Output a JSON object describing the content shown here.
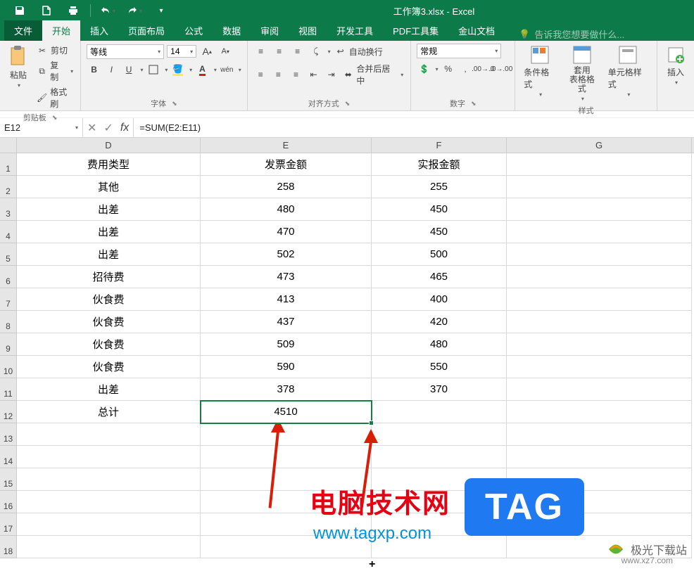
{
  "title": "工作簿3.xlsx - Excel",
  "tabs": {
    "file": "文件",
    "home": "开始",
    "insert": "插入",
    "layout": "页面布局",
    "formulas": "公式",
    "data": "数据",
    "review": "审阅",
    "view": "视图",
    "dev": "开发工具",
    "pdf": "PDF工具集",
    "ks": "金山文档"
  },
  "tellme": "告诉我您想要做什么...",
  "clipboard": {
    "label": "剪贴板",
    "paste": "粘贴",
    "cut": "剪切",
    "copy": "复制",
    "painter": "格式刷"
  },
  "font": {
    "label": "字体",
    "name": "等线",
    "size": "14",
    "bold": "B",
    "italic": "I",
    "underline": "U",
    "a_big": "A",
    "a_small": "A",
    "wen": "wén"
  },
  "align": {
    "label": "对齐方式",
    "wrap": "自动换行",
    "merge": "合并后居中"
  },
  "number": {
    "label": "数字",
    "format": "常规"
  },
  "styles": {
    "label": "样式",
    "cond": "条件格式",
    "table": "套用\n表格格式",
    "cell": "单元格样式"
  },
  "cells": {
    "insert": "插入"
  },
  "namebox": "E12",
  "formula": "=SUM(E2:E11)",
  "columns": [
    "D",
    "E",
    "F",
    "G"
  ],
  "row_numbers": [
    "1",
    "2",
    "3",
    "4",
    "5",
    "6",
    "7",
    "8",
    "9",
    "10",
    "11",
    "12",
    "13",
    "14",
    "15",
    "16",
    "17",
    "18"
  ],
  "table": {
    "header": {
      "d": "费用类型",
      "e": "发票金额",
      "f": "实报金额"
    },
    "rows": [
      {
        "d": "其他",
        "e": "258",
        "f": "255"
      },
      {
        "d": "出差",
        "e": "480",
        "f": "450"
      },
      {
        "d": "出差",
        "e": "470",
        "f": "450"
      },
      {
        "d": "出差",
        "e": "502",
        "f": "500"
      },
      {
        "d": "招待费",
        "e": "473",
        "f": "465"
      },
      {
        "d": "伙食费",
        "e": "413",
        "f": "400"
      },
      {
        "d": "伙食费",
        "e": "437",
        "f": "420"
      },
      {
        "d": "伙食费",
        "e": "509",
        "f": "480"
      },
      {
        "d": "伙食费",
        "e": "590",
        "f": "550"
      },
      {
        "d": "出差",
        "e": "378",
        "f": "370"
      }
    ],
    "total": {
      "d": "总计",
      "e": "4510",
      "f": ""
    }
  },
  "watermark1": "电脑技术网",
  "watermark2": "www.tagxp.com",
  "tag": "TAG",
  "jg": "极光下载站",
  "jg_url": "www.xz7.com"
}
